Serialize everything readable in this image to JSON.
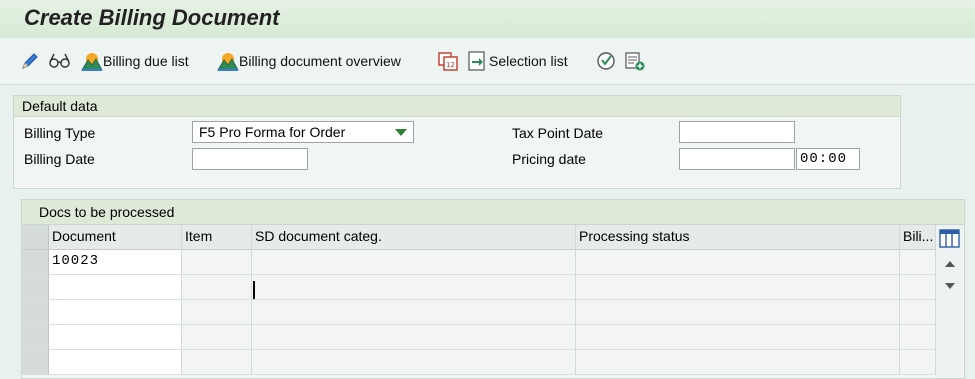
{
  "title": "Create Billing Document",
  "toolbar": {
    "edit_icon": "pencil-icon",
    "display_icon": "glasses-icon",
    "billing_due_list": "Billing due list",
    "billing_document_overview": "Billing document overview",
    "selection_list": "Selection list",
    "calendar_icon": "calendar-icon",
    "execute_icon": "execute-icon",
    "add_icon": "add-document-icon"
  },
  "default_data": {
    "header": "Default data",
    "billing_type_label": "Billing Type",
    "billing_type_value": "F5 Pro Forma for Order",
    "billing_date_label": "Billing Date",
    "billing_date_value": "",
    "tax_point_date_label": "Tax Point Date",
    "tax_point_date_value": "",
    "pricing_date_label": "Pricing date",
    "pricing_date_value": "",
    "pricing_time_value": "00:00"
  },
  "docs": {
    "header": "Docs to be processed",
    "columns": [
      "Document",
      "Item",
      "SD document categ.",
      "Processing status",
      "Bili..."
    ],
    "rows": [
      [
        "10023",
        "",
        "",
        "",
        ""
      ],
      [
        "",
        "",
        "",
        "",
        ""
      ],
      [
        "",
        "",
        "",
        "",
        ""
      ],
      [
        "",
        "",
        "",
        "",
        ""
      ],
      [
        "",
        "",
        "",
        "",
        ""
      ]
    ]
  },
  "colors": {
    "title_bar": "#d7e9d5",
    "group_header": "#dfe9d8",
    "background": "#e9f1ef",
    "dropdown_arrow": "#2e7d32"
  }
}
